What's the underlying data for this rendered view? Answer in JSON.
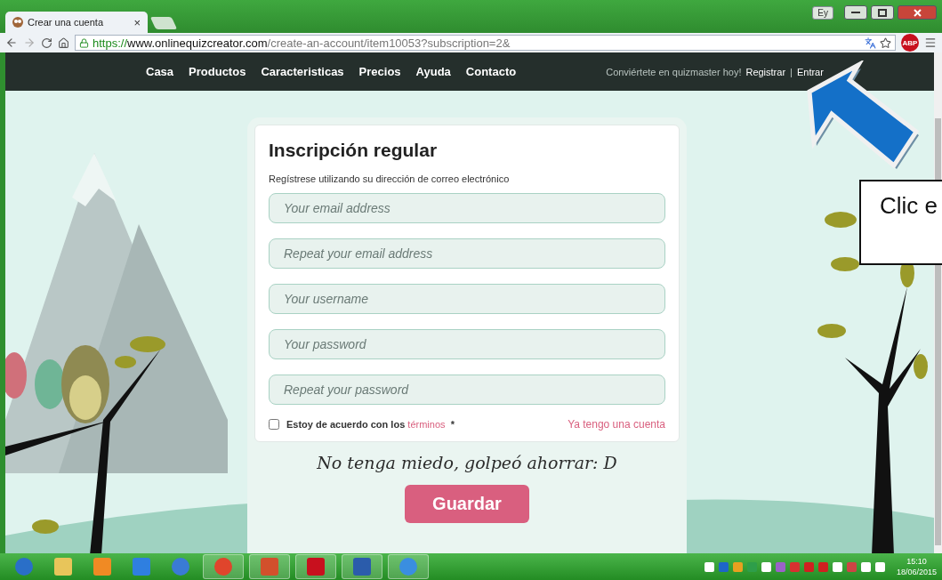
{
  "browser": {
    "tab": {
      "title": "Crear una cuenta",
      "close": "×"
    },
    "profile": "Ey",
    "address": {
      "scheme": "https://",
      "host": "www.onlinequizcreator.com",
      "path": "/create-an-account/item10053?subscription=2&"
    },
    "adblock": "ABP"
  },
  "nav": {
    "items": [
      "Casa",
      "Productos",
      "Caracteristicas",
      "Precios",
      "Ayuda",
      "Contacto"
    ],
    "promo": "Conviértete en quizmaster hoy!",
    "links": [
      "Registrar",
      "Entrar"
    ],
    "separator": "|"
  },
  "form": {
    "title": "Inscripción regular",
    "subtitle": "Regístrese utilizando su dirección de correo electrónico",
    "fields": [
      {
        "placeholder": "Your email address"
      },
      {
        "placeholder": "Repeat your email address"
      },
      {
        "placeholder": "Your username"
      },
      {
        "placeholder": "Your password"
      },
      {
        "placeholder": "Repeat your password"
      }
    ],
    "terms": {
      "checked": false,
      "label": "Estoy de acuerdo con los",
      "link": "términos",
      "required_mark": "*"
    },
    "login_link": "Ya tengo una cuenta",
    "tagline": "No tenga miedo, golpeó ahorrar: D",
    "submit": "Guardar"
  },
  "callout": {
    "text": "Clic e"
  },
  "taskbar": {
    "time": "15:10",
    "date": "18/06/2015"
  }
}
